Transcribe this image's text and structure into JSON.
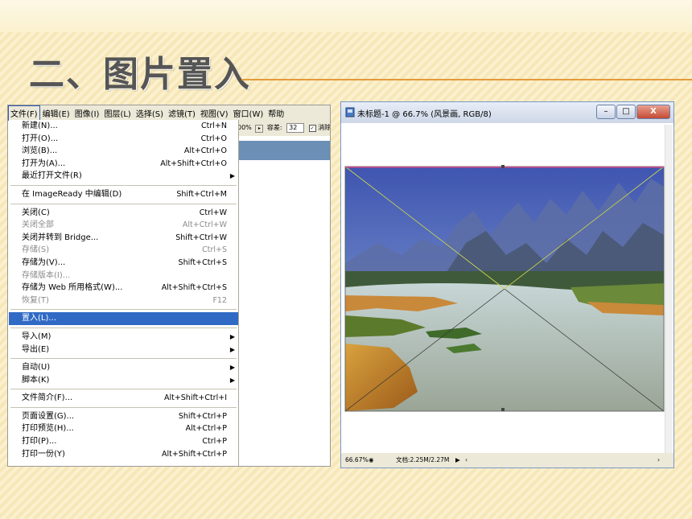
{
  "slide": {
    "title": "二、图片置入"
  },
  "menubar": {
    "items": [
      "文件(F)",
      "编辑(E)",
      "图像(I)",
      "图层(L)",
      "选择(S)",
      "滤镜(T)",
      "视图(V)",
      "窗口(W)",
      "帮助"
    ]
  },
  "options_bar": {
    "zoom_fragment": "00%",
    "tolerance_label": "容差:",
    "tolerance_value": "32",
    "antialias_label": "消除"
  },
  "file_menu": {
    "groups": [
      [
        {
          "label": "新建(N)...",
          "shortcut": "Ctrl+N"
        },
        {
          "label": "打开(O)...",
          "shortcut": "Ctrl+O"
        },
        {
          "label": "浏览(B)...",
          "shortcut": "Alt+Ctrl+O"
        },
        {
          "label": "打开为(A)...",
          "shortcut": "Alt+Shift+Ctrl+O"
        },
        {
          "label": "最近打开文件(R)",
          "submenu": true
        }
      ],
      [
        {
          "label": "在 ImageReady 中编辑(D)",
          "shortcut": "Shift+Ctrl+M"
        }
      ],
      [
        {
          "label": "关闭(C)",
          "shortcut": "Ctrl+W"
        },
        {
          "label": "关闭全部",
          "shortcut": "Alt+Ctrl+W",
          "disabled": true
        },
        {
          "label": "关闭并转到 Bridge...",
          "shortcut": "Shift+Ctrl+W"
        },
        {
          "label": "存储(S)",
          "shortcut": "Ctrl+S",
          "disabled": true
        },
        {
          "label": "存储为(V)...",
          "shortcut": "Shift+Ctrl+S"
        },
        {
          "label": "存储版本(I)...",
          "disabled": true
        },
        {
          "label": "存储为 Web 所用格式(W)...",
          "shortcut": "Alt+Shift+Ctrl+S"
        },
        {
          "label": "恢复(T)",
          "shortcut": "F12",
          "disabled": true
        }
      ],
      [
        {
          "label": "置入(L)...",
          "highlighted": true
        }
      ],
      [
        {
          "label": "导入(M)",
          "submenu": true
        },
        {
          "label": "导出(E)",
          "submenu": true
        }
      ],
      [
        {
          "label": "自动(U)",
          "submenu": true
        },
        {
          "label": "脚本(K)",
          "submenu": true
        }
      ],
      [
        {
          "label": "文件简介(F)...",
          "shortcut": "Alt+Shift+Ctrl+I"
        }
      ],
      [
        {
          "label": "页面设置(G)...",
          "shortcut": "Shift+Ctrl+P"
        },
        {
          "label": "打印预览(H)...",
          "shortcut": "Alt+Ctrl+P"
        },
        {
          "label": "打印(P)...",
          "shortcut": "Ctrl+P"
        },
        {
          "label": "打印一份(Y)",
          "shortcut": "Alt+Shift+Ctrl+P"
        }
      ]
    ]
  },
  "doc_window": {
    "title": "未标题-1 @ 66.7% (风景画, RGB/8)",
    "status_zoom": "66.67%",
    "status_doc": "文档:2.25M/2.27M"
  },
  "colors": {
    "menu_highlight": "#316ac5",
    "title_rule": "#e39a3b",
    "slide_background": "#fbf1cf"
  }
}
